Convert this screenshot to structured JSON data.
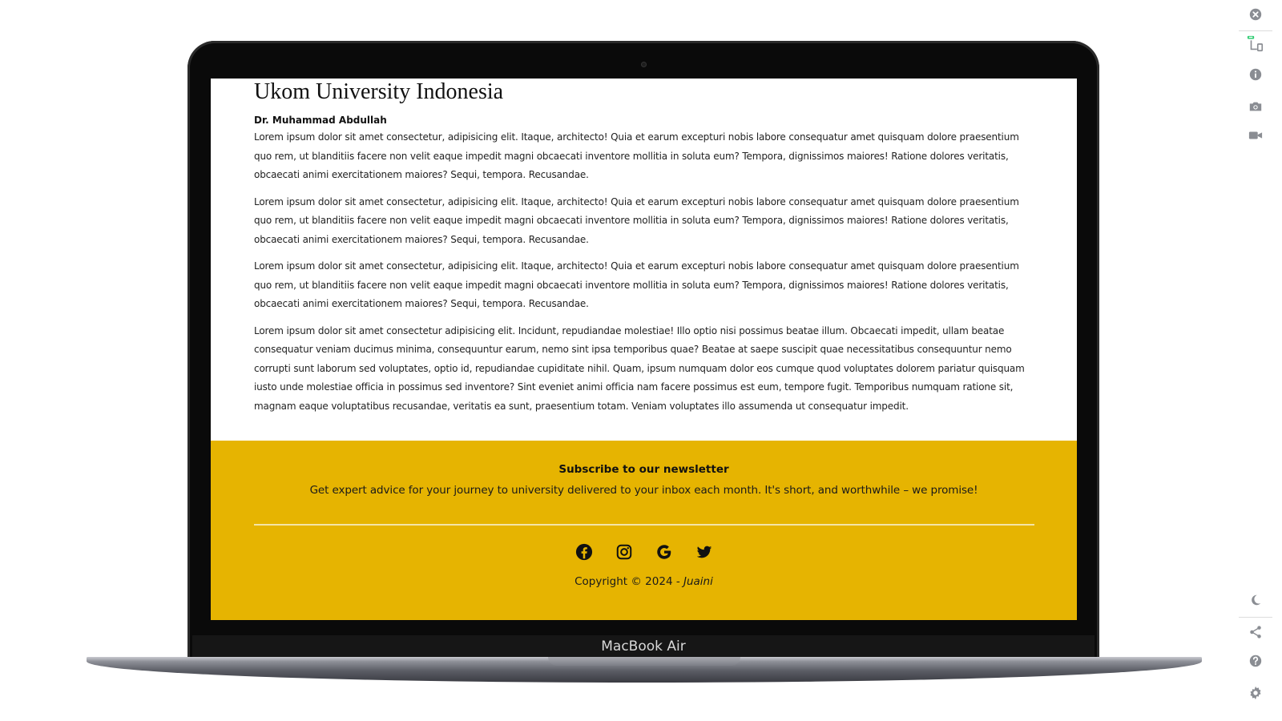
{
  "device": {
    "label": "MacBook Air"
  },
  "article": {
    "title": "Ukom University Indonesia",
    "author": "Dr. Muhammad Abdullah",
    "paragraphs": [
      "Lorem ipsum dolor sit amet consectetur, adipisicing elit. Itaque, architecto! Quia et earum excepturi nobis labore consequatur amet quisquam dolore praesentium quo rem, ut blanditiis facere non velit eaque impedit magni obcaecati inventore mollitia in soluta eum? Tempora, dignissimos maiores! Ratione dolores veritatis, obcaecati animi exercitationem maiores? Sequi, tempora. Recusandae.",
      "Lorem ipsum dolor sit amet consectetur, adipisicing elit. Itaque, architecto! Quia et earum excepturi nobis labore consequatur amet quisquam dolore praesentium quo rem, ut blanditiis facere non velit eaque impedit magni obcaecati inventore mollitia in soluta eum? Tempora, dignissimos maiores! Ratione dolores veritatis, obcaecati animi exercitationem maiores? Sequi, tempora. Recusandae.",
      "Lorem ipsum dolor sit amet consectetur, adipisicing elit. Itaque, architecto! Quia et earum excepturi nobis labore consequatur amet quisquam dolore praesentium quo rem, ut blanditiis facere non velit eaque impedit magni obcaecati inventore mollitia in soluta eum? Tempora, dignissimos maiores! Ratione dolores veritatis, obcaecati animi exercitationem maiores? Sequi, tempora. Recusandae.",
      "Lorem ipsum dolor sit amet consectetur adipisicing elit. Incidunt, repudiandae molestiae! Illo optio nisi possimus beatae illum. Obcaecati impedit, ullam beatae consequatur veniam ducimus minima, consequuntur earum, nemo sint ipsa temporibus quae? Beatae at saepe suscipit quae necessitatibus consequuntur nemo corrupti sunt laborum sed voluptates, optio id, repudiandae cupiditate nihil. Quam, ipsum numquam dolor eos cumque quod voluptates dolorem pariatur quisquam iusto unde molestiae officia in possimus sed inventore? Sint eveniet animi officia nam facere possimus est eum, tempore fugit. Temporibus numquam ratione sit, magnam eaque voluptatibus recusandae, veritatis ea sunt, praesentium totam. Veniam voluptates illo assumenda ut consequatur impedit."
    ]
  },
  "footer": {
    "newsletter_title": "Subscribe to our newsletter",
    "newsletter_text": "Get expert advice for your journey to university delivered to your inbox each month. It's short, and worthwhile – we promise!",
    "socials": [
      "facebook-icon",
      "instagram-icon",
      "google-icon",
      "twitter-icon"
    ],
    "copyright_prefix": "Copyright © 2024 - ",
    "copyright_name": "Juaini",
    "background_color": "#e6b401"
  },
  "rail": {
    "icons": [
      "close-icon",
      "responsive-view-icon",
      "info-icon",
      "camera-icon",
      "video-icon",
      "dark-mode-icon",
      "share-icon",
      "help-icon",
      "settings-icon"
    ]
  }
}
